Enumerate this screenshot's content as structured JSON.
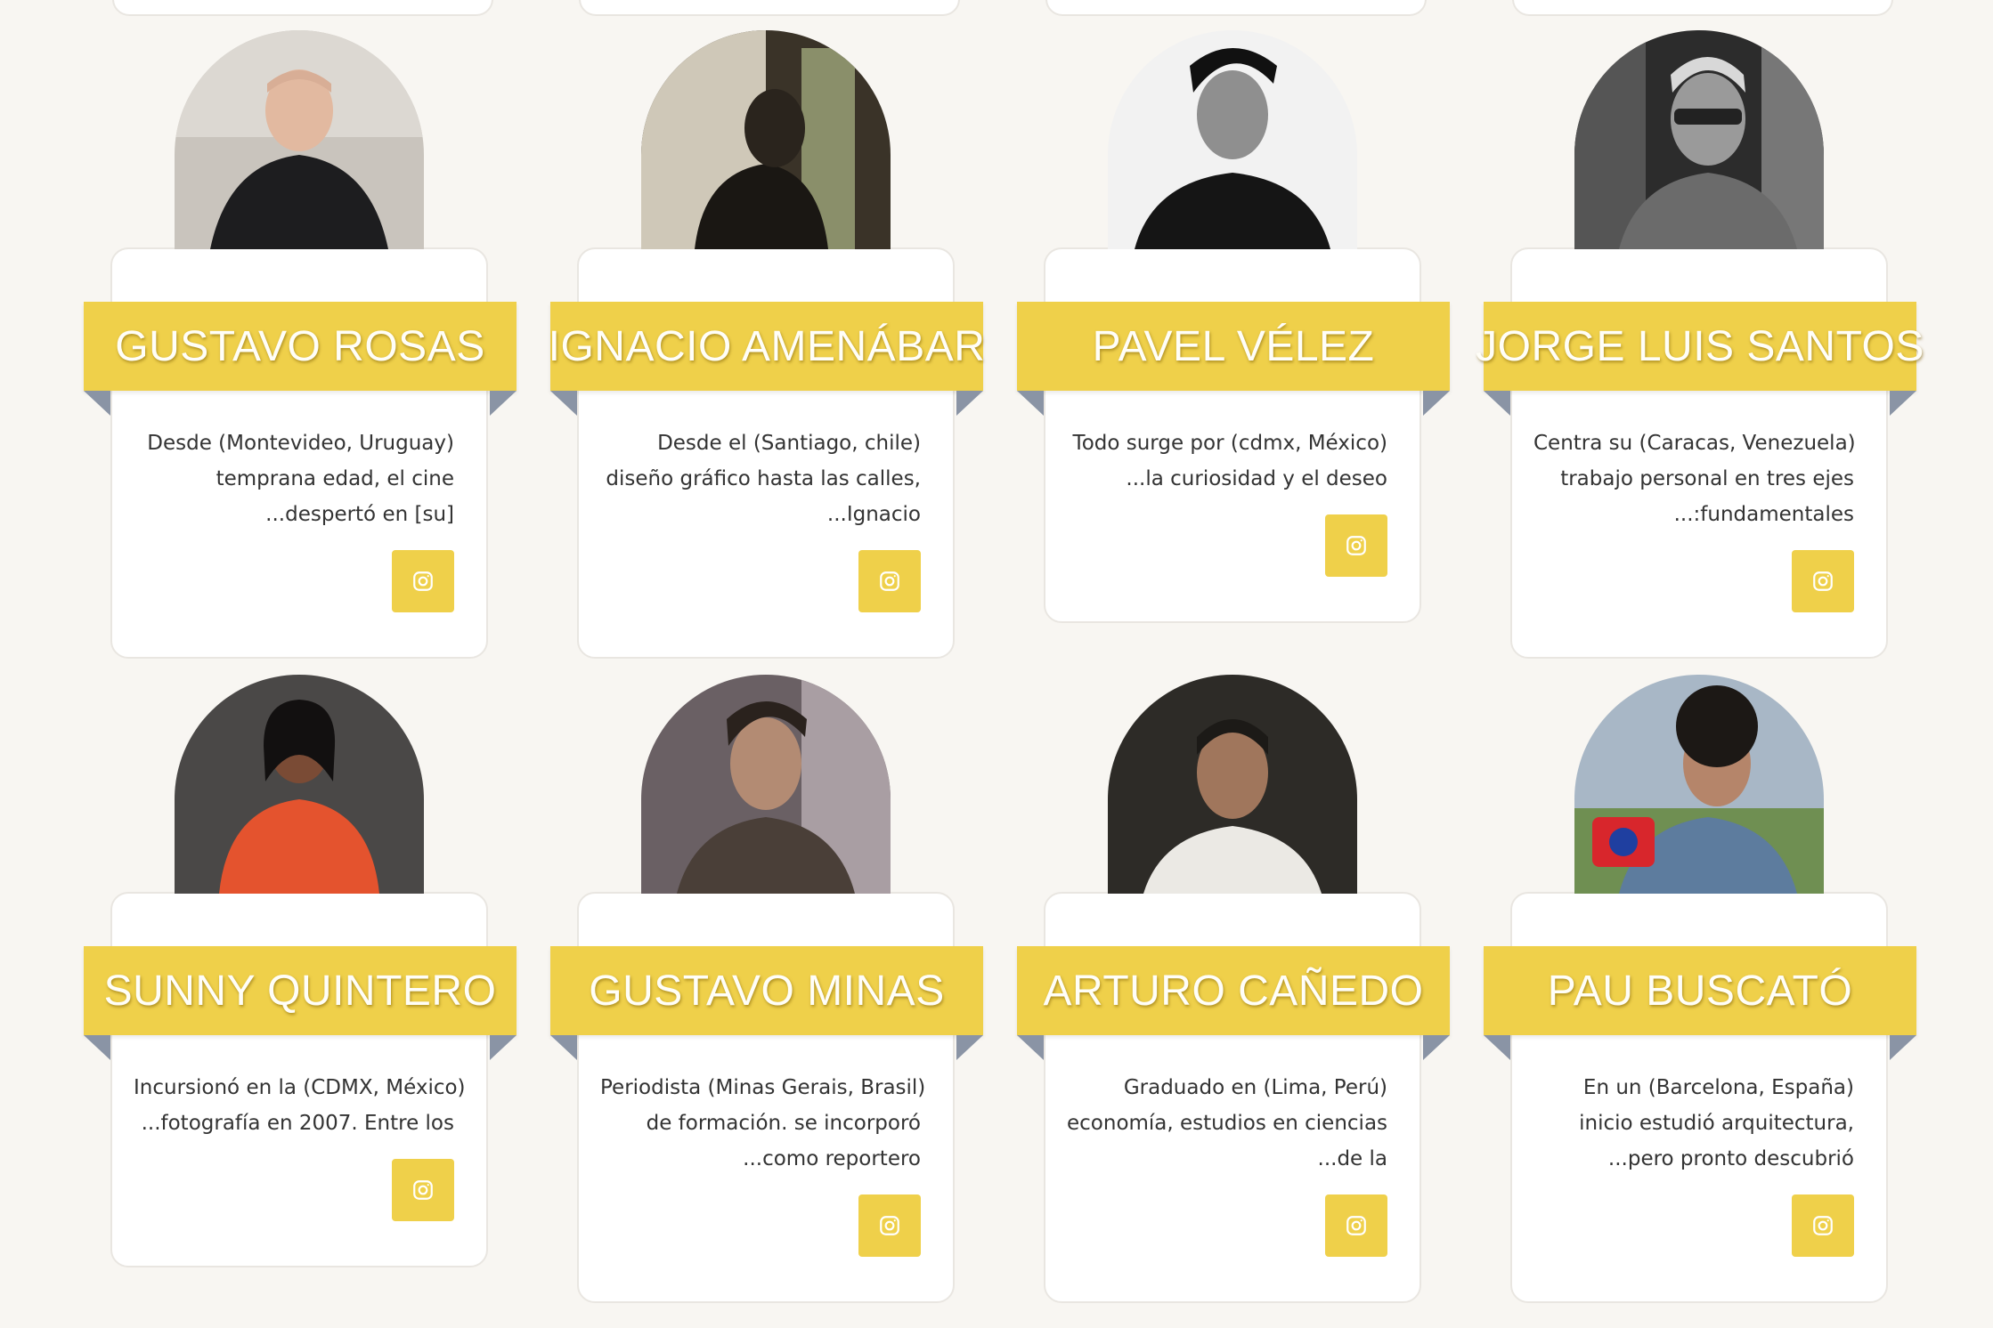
{
  "colors": {
    "background": "#f8f6f2",
    "ribbon": "#efd04a",
    "ribbon_fold": "#8a94a5",
    "card_border": "#e9e6e1"
  },
  "icons": {
    "social_button": "instagram-icon"
  },
  "people": [
    {
      "name": "GUSTAVO ROSAS",
      "bio": [
        "Desde (Montevideo, Uruguay)",
        "temprana edad, el cine",
        "...despertó en [su]"
      ]
    },
    {
      "name": "IGNACIO AMENÁBAR",
      "bio": [
        "Desde el (Santiago, chile)",
        "diseño gráfico hasta las calles,",
        "...Ignacio"
      ]
    },
    {
      "name": "PAVEL VÉLEZ",
      "bio": [
        "Todo surge por (cdmx, México)",
        "...la curiosidad y el deseo"
      ]
    },
    {
      "name": "JORGE LUIS SANTOS",
      "bio": [
        "Centra su (Caracas, Venezuela)",
        "trabajo personal en tres ejes",
        "...:fundamentales"
      ]
    },
    {
      "name": "SUNNY QUINTERO",
      "bio": [
        "Incursionó en la (CDMX, México)",
        "...fotografía en 2007. Entre los"
      ]
    },
    {
      "name": "GUSTAVO MINAS",
      "bio": [
        "Periodista (Minas Gerais, Brasil)",
        "de formación. se incorporó",
        "...como reportero"
      ]
    },
    {
      "name": "ARTURO CAÑEDO",
      "bio": [
        "Graduado en (Lima, Perú)",
        "economía, estudios en ciencias",
        "...de la"
      ]
    },
    {
      "name": "PAU BUSCATÓ",
      "bio": [
        "En un (Barcelona, España)",
        "inicio estudió arquitectura,",
        "...pero pronto descubrió"
      ]
    }
  ]
}
